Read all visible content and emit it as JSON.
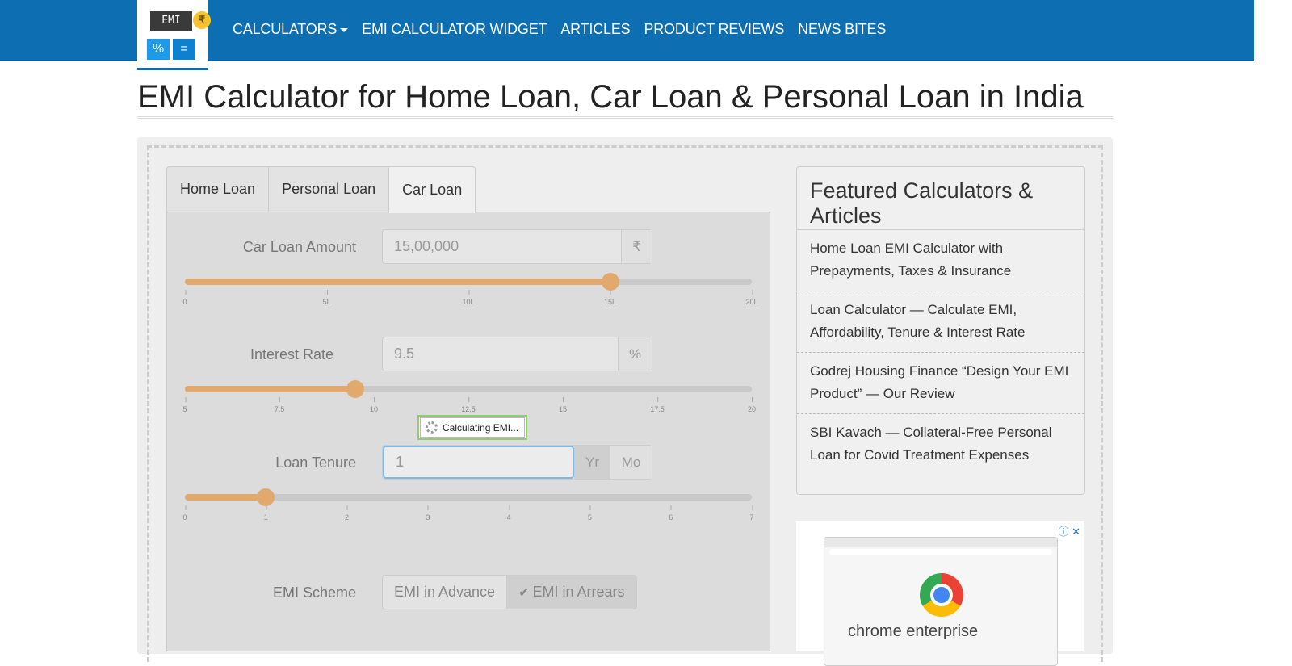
{
  "header": {
    "logo": {
      "screen_text": "EMI",
      "coin_symbol": "₹",
      "key_left": "%",
      "key_right": "="
    },
    "nav": [
      "CALCULATORS",
      "EMI CALCULATOR WIDGET",
      "ARTICLES",
      "PRODUCT REVIEWS",
      "NEWS BITES"
    ],
    "brand_color": "#0d6fb1"
  },
  "page_title": "EMI Calculator for Home Loan, Car Loan & Personal Loan in India",
  "tabs": [
    {
      "label": "Home Loan",
      "active": false
    },
    {
      "label": "Personal Loan",
      "active": false
    },
    {
      "label": "Car Loan",
      "active": true
    }
  ],
  "form": {
    "loan_amount": {
      "label": "Car Loan Amount",
      "value": "15,00,000",
      "unit": "₹",
      "slider_value": 0.75,
      "ticks": [
        "0",
        "5L",
        "10L",
        "15L",
        "20L"
      ]
    },
    "interest_rate": {
      "label": "Interest Rate",
      "value": "9.5",
      "unit": "%",
      "slider_value": 0.3,
      "ticks": [
        "5",
        "7.5",
        "10",
        "12.5",
        "15",
        "17.5",
        "20"
      ]
    },
    "loan_tenure": {
      "label": "Loan Tenure",
      "value": "1",
      "unit_year": "Yr",
      "unit_month": "Mo",
      "slider_value": 0.142857,
      "ticks": [
        "0",
        "1",
        "2",
        "3",
        "4",
        "5",
        "6",
        "7"
      ]
    },
    "emi_scheme": {
      "label": "EMI Scheme",
      "options": [
        "EMI in Advance",
        "EMI in Arrears"
      ],
      "selected": "EMI in Arrears"
    },
    "status_tooltip": "Calculating EMI..."
  },
  "sidebar": {
    "title": "Featured Calculators & Articles",
    "items": [
      "Home Loan EMI Calculator with Prepayments, Taxes & Insurance",
      "Loan Calculator — Calculate EMI, Affordability, Tenure & Interest Rate",
      "Godrej Housing Finance “Design Your EMI Product” — Our Review",
      "SBI Kavach — Collateral-Free Personal Loan for Covid Treatment Expenses"
    ]
  },
  "ad": {
    "icons": [
      "info-icon",
      "close-icon"
    ],
    "text": "chrome enterprise"
  }
}
